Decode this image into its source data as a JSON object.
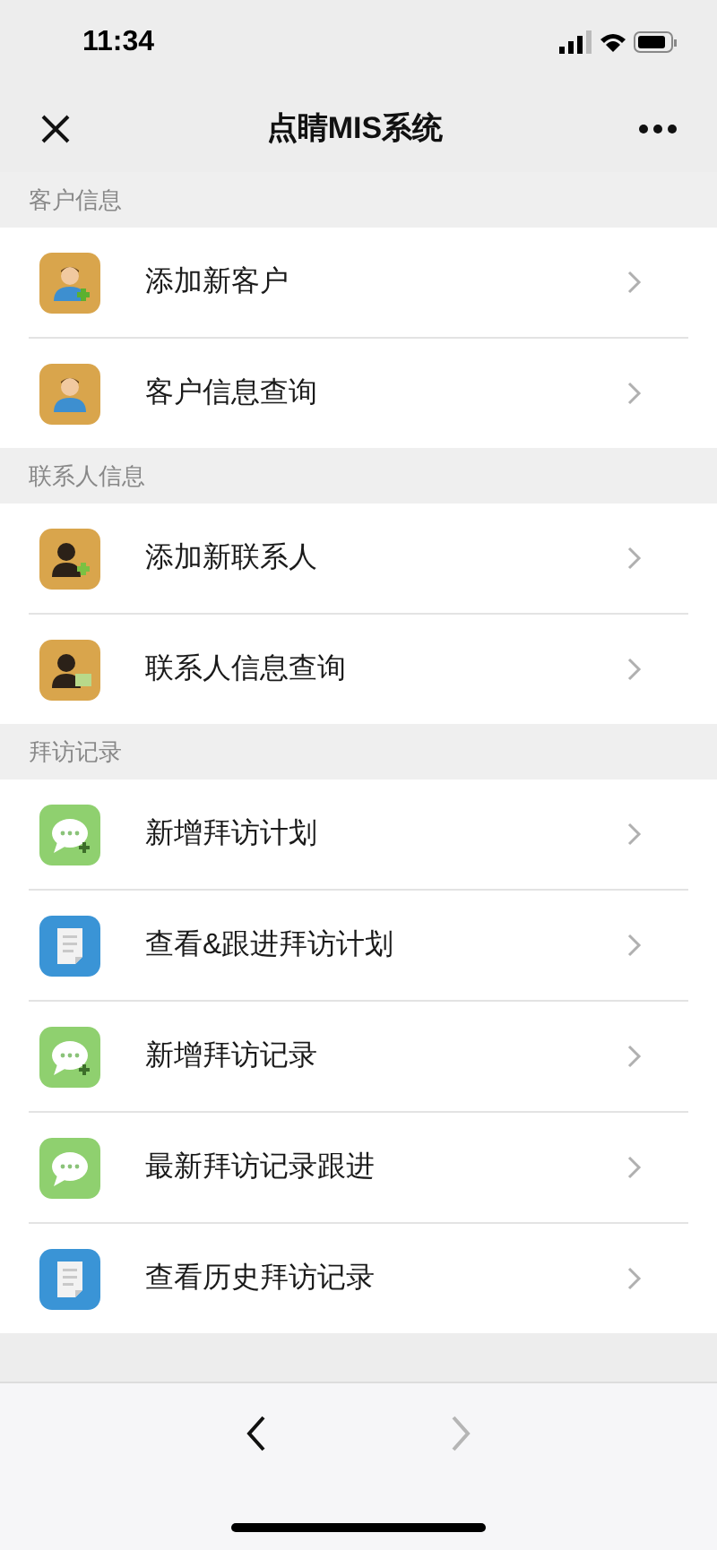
{
  "status_bar": {
    "time": "11:34"
  },
  "nav": {
    "title": "点睛MIS系统"
  },
  "sections": [
    {
      "header": "客户信息",
      "items": [
        {
          "label": "添加新客户",
          "kind": "person-add"
        },
        {
          "label": "客户信息查询",
          "kind": "person"
        }
      ]
    },
    {
      "header": "联系人信息",
      "items": [
        {
          "label": "添加新联系人",
          "kind": "contact-add"
        },
        {
          "label": "联系人信息查询",
          "kind": "contact-card"
        }
      ]
    },
    {
      "header": "拜访记录",
      "items": [
        {
          "label": "新增拜访计划",
          "kind": "chat-add"
        },
        {
          "label": "查看&跟进拜访计划",
          "kind": "document"
        },
        {
          "label": "新增拜访记录",
          "kind": "chat-add"
        },
        {
          "label": "最新拜访记录跟进",
          "kind": "chat"
        },
        {
          "label": "查看历史拜访记录",
          "kind": "document"
        }
      ]
    }
  ],
  "toolbar": {
    "back": {
      "disabled": false
    },
    "forward": {
      "disabled": true
    }
  }
}
